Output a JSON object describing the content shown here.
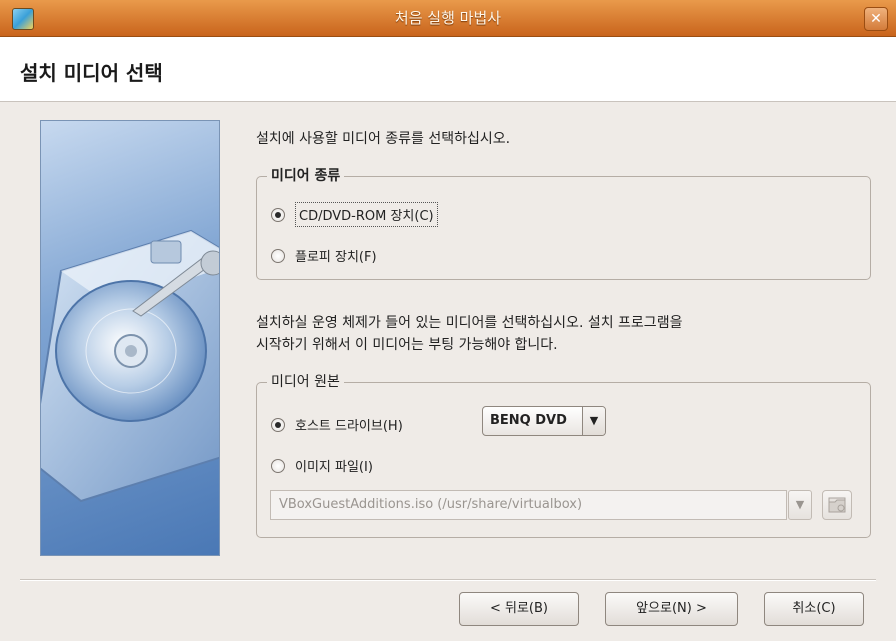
{
  "window": {
    "title": "처음 실행 마법사",
    "close_glyph": "✕"
  },
  "header": {
    "title": "설치 미디어 선택"
  },
  "intro_text": "설치에 사용할 미디어 종류를 선택하십시오.",
  "media_type": {
    "legend": "미디어 종류",
    "options": [
      {
        "label": "CD/DVD-ROM 장치(C)",
        "checked": true
      },
      {
        "label": "플로피 장치(F)",
        "checked": false
      }
    ]
  },
  "description_line1": "설치하실 운영 체제가 들어 있는 미디어를 선택하십시오. 설치 프로그램을",
  "description_line2": "시작하기 위해서 이 미디어는 부팅 가능해야 합니다.",
  "media_source": {
    "legend": "미디어 원본",
    "host_drive_label": "호스트 드라이브(H)",
    "host_drive_checked": true,
    "host_drive_value": "BENQ DVD",
    "image_file_label": "이미지 파일(I)",
    "image_file_checked": false,
    "image_path": "VBoxGuestAdditions.iso (/usr/share/virtualbox)"
  },
  "buttons": {
    "back": "< 뒤로(B)",
    "next": "앞으로(N) >",
    "cancel": "취소(C)"
  },
  "icons": {
    "app": "virtualbox-icon",
    "close": "close-icon",
    "combo_arrow": "chevron-down-icon",
    "browse": "folder-open-icon",
    "side_image": "hard-disk-illustration"
  },
  "colors": {
    "titlebar": "#d9792e",
    "window_bg": "#efebe7",
    "side_panel": "#6f97cc"
  }
}
